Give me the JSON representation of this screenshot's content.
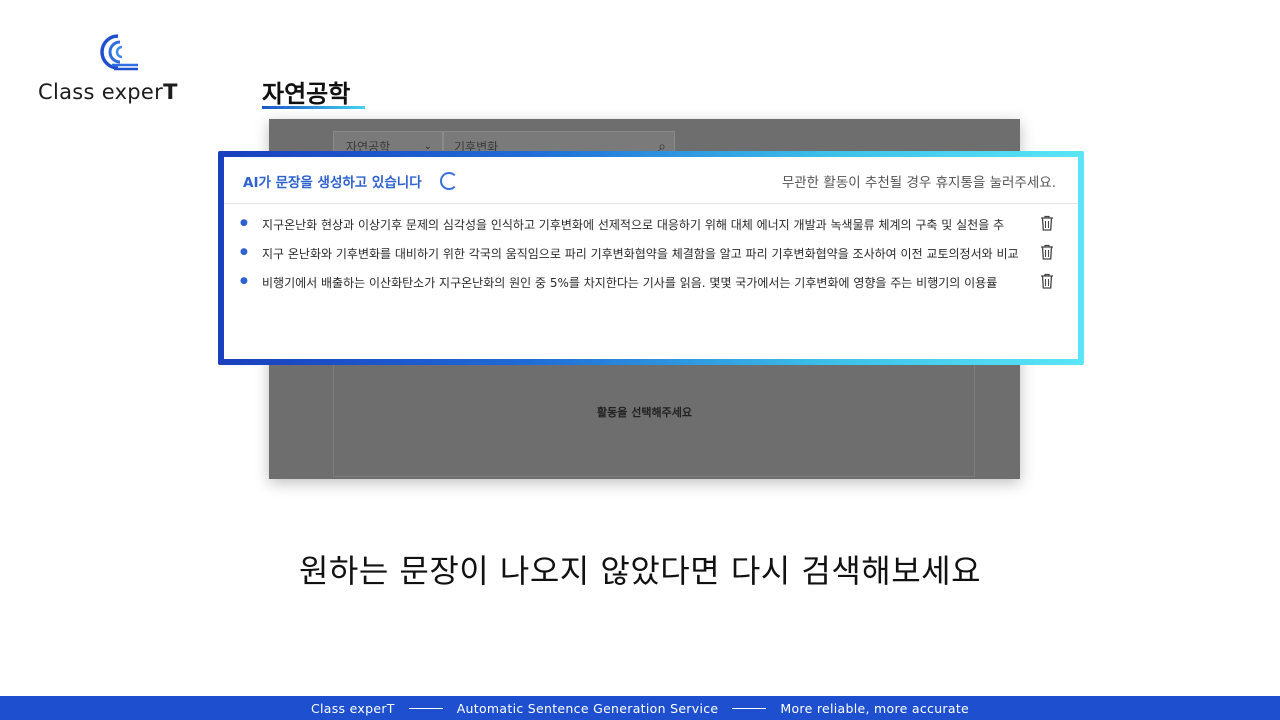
{
  "brand": {
    "logo_text_light": "Class exper",
    "logo_text_bold": "T",
    "logo_icon": "class-expert-logo-icon"
  },
  "subject": "자연공학",
  "panel": {
    "select_value": "자연공학",
    "search_value": "기후변화",
    "hint": "활동을 선택해주세요"
  },
  "card": {
    "status": "AI가 문장을 생성하고 있습니다",
    "note": "무관한 활동이 추천될 경우 휴지통을 눌러주세요.",
    "sentences": [
      "지구온난화 현상과 이상기후 문제의 심각성을 인식하고 기후변화에 선제적으로 대응하기 위해 대체 에너지 개발과 녹색물류 체계의 구축 및 실천을 추",
      "지구 온난화와 기후변화를 대비하기 위한 각국의 움직임으로 파리 기후변화협약을 체결함을 알고 파리 기후변화협약을 조사하여 이전 교토의정서와 비교",
      "비행기에서 배출하는 이산화탄소가 지구온난화의 원인 중 5%를 차지한다는 기사를 읽음. 몇몇 국가에서는 기후변화에 영향을 주는 비행기의 이용률"
    ]
  },
  "caption": "원하는 문장이 나오지 않았다면 다시 검색해보세요",
  "footer": {
    "items": [
      "Class experT",
      "Automatic Sentence Generation Service",
      "More reliable, more accurate"
    ]
  },
  "colors": {
    "accent": "#1e4fcf",
    "accent_light": "#45d3f0"
  }
}
